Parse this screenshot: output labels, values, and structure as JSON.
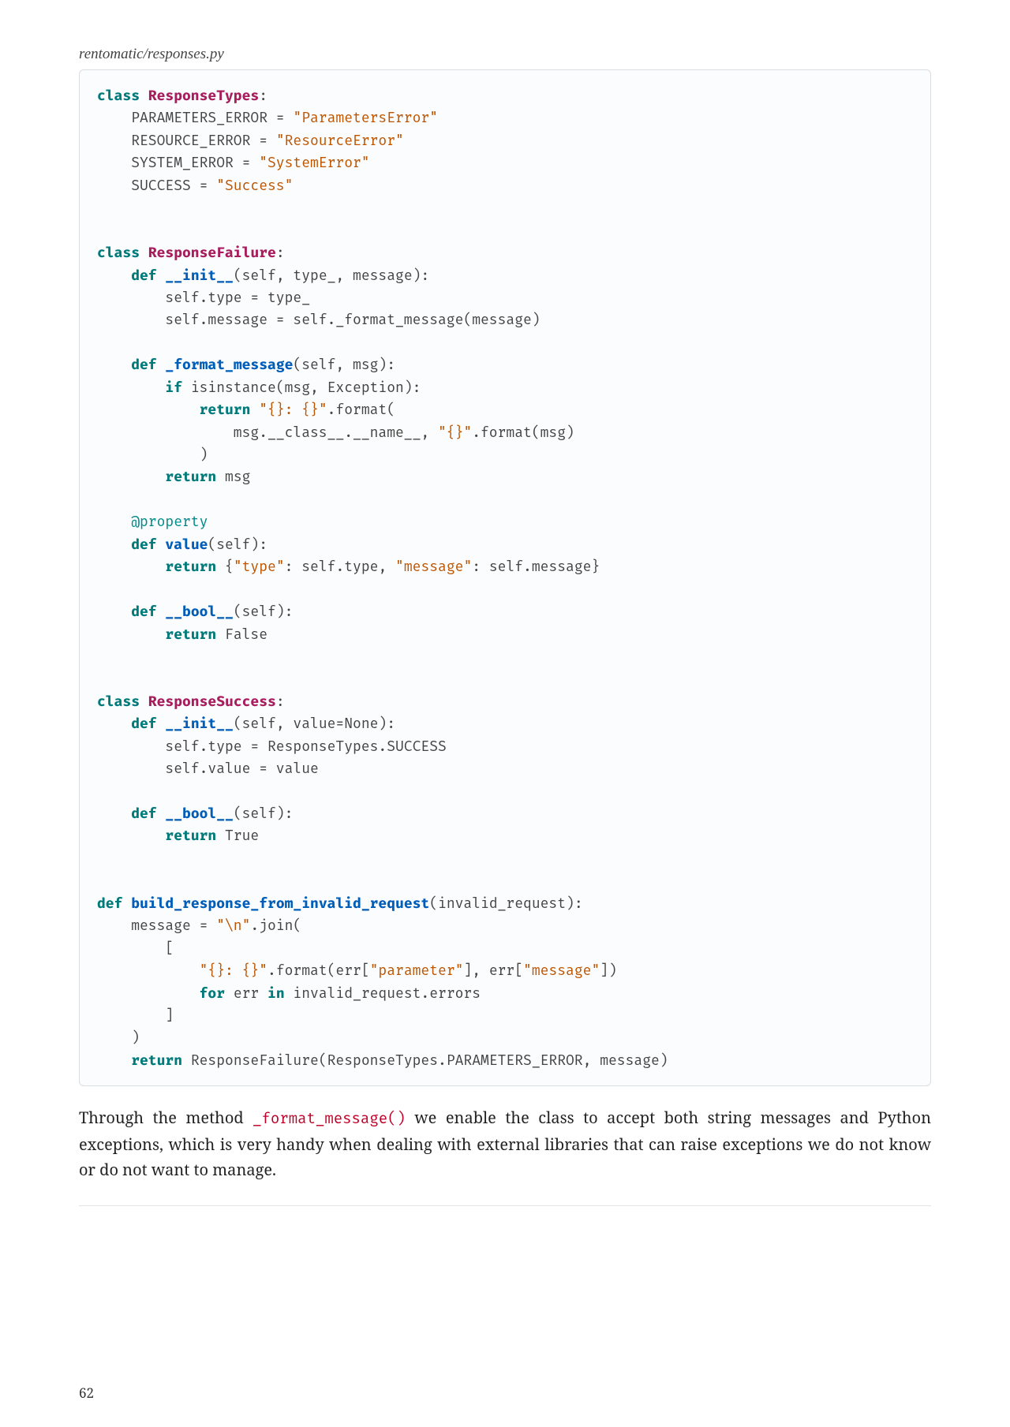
{
  "caption": "rentomatic/responses.py",
  "code": {
    "t0": "class",
    "t1": " ",
    "t2": "ResponseTypes",
    "t3": ":",
    "t4": "    PARAMETERS_ERROR = ",
    "t5": "\"ParametersError\"",
    "t6": "    RESOURCE_ERROR = ",
    "t7": "\"ResourceError\"",
    "t8": "    SYSTEM_ERROR = ",
    "t9": "\"SystemError\"",
    "t10": "    SUCCESS = ",
    "t11": "\"Success\"",
    "t12": "class",
    "t13": " ",
    "t14": "ResponseFailure",
    "t15": ":",
    "t16": "    ",
    "t17": "def",
    "t18": " ",
    "t19": "__init__",
    "t20": "(self, type_, message):",
    "t21": "        self.type = type_",
    "t22": "        self.message = self._format_message(message)",
    "t23": "    ",
    "t24": "def",
    "t25": " ",
    "t26": "_format_message",
    "t27": "(self, msg):",
    "t28": "        ",
    "t29": "if",
    "t30": " isinstance(msg, Exception):",
    "t31": "            ",
    "t32": "return",
    "t33": " ",
    "t34": "\"{}: {}\"",
    "t35": ".format(",
    "t36": "                msg.__class__.__name__, ",
    "t37": "\"{}\"",
    "t38": ".format(msg)",
    "t39": "            )",
    "t40": "        ",
    "t41": "return",
    "t42": " msg",
    "t43": "    ",
    "t44": "@property",
    "t45": "    ",
    "t46": "def",
    "t47": " ",
    "t48": "value",
    "t49": "(self):",
    "t50": "        ",
    "t51": "return",
    "t52": " {",
    "t53": "\"type\"",
    "t54": ": self.type, ",
    "t55": "\"message\"",
    "t56": ": self.message}",
    "t57": "    ",
    "t58": "def",
    "t59": " ",
    "t60": "__bool__",
    "t61": "(self):",
    "t62": "        ",
    "t63": "return",
    "t64": " False",
    "t65": "class",
    "t66": " ",
    "t67": "ResponseSuccess",
    "t68": ":",
    "t69": "    ",
    "t70": "def",
    "t71": " ",
    "t72": "__init__",
    "t73": "(self, value=None):",
    "t74": "        self.type = ResponseTypes.SUCCESS",
    "t75": "        self.value = value",
    "t76": "    ",
    "t77": "def",
    "t78": " ",
    "t79": "__bool__",
    "t80": "(self):",
    "t81": "        ",
    "t82": "return",
    "t83": " True",
    "t84": "def",
    "t85": " ",
    "t86": "build_response_from_invalid_request",
    "t87": "(invalid_request):",
    "t88": "    message = ",
    "t89": "\"\\n\"",
    "t90": ".join(",
    "t91": "        [",
    "t92": "            ",
    "t93": "\"{}: {}\"",
    "t94": ".format(err[",
    "t95": "\"parameter\"",
    "t96": "], err[",
    "t97": "\"message\"",
    "t98": "])",
    "t99": "            ",
    "t100": "for",
    "t101": " err ",
    "t102": "in",
    "t103": " invalid_request.errors",
    "t104": "        ]",
    "t105": "    )",
    "t106": "    ",
    "t107": "return",
    "t108": " ResponseFailure(ResponseTypes.PARAMETERS_ERROR, message)"
  },
  "body": {
    "p1a": "Through the method ",
    "p1b": "_format_message()",
    "p1c": " we enable the class to accept both string messages and Python exceptions, which is very handy when dealing with external libraries that can raise exceptions we do not know or do not want to manage."
  },
  "page_number": "62"
}
